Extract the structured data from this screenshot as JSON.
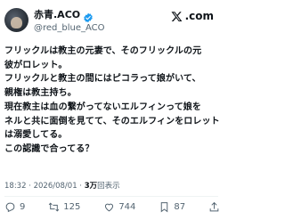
{
  "author": {
    "display_name": "赤青.ACO",
    "handle": "@red_blue_ACO"
  },
  "brand": {
    "logo_text": ".com"
  },
  "tweet": {
    "lines": [
      "フリックルは教主の元妻で、そのフリックルの元",
      "彼がロレット。",
      "フリックルと教主の間にはピコラって娘がいて、",
      "親権は教主持ち。",
      "現在教主は血の繋がってないエルフィンって娘を",
      "ネルと共に面倒を見てて、そのエルフィンをロレット",
      "は溺愛してる。",
      "この認識で合ってる？"
    ]
  },
  "meta": {
    "time": "18:32",
    "sep1": " · ",
    "date": "2026/08/01",
    "sep2": " · ",
    "views_count": "3万",
    "views_label": "回表示"
  },
  "actions": {
    "reply_count": "9",
    "retweet_count": "125",
    "like_count": "744",
    "bookmark_count": "87"
  },
  "colors": {
    "text": "#0f1419",
    "secondary": "#536471",
    "verified": "#1d9bf0"
  }
}
